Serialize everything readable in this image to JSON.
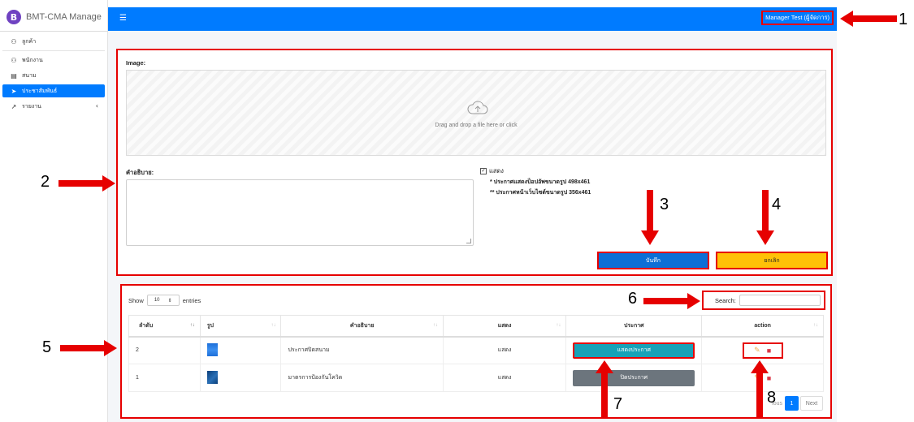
{
  "brand": {
    "logo_letter": "B",
    "name": "BMT-CMA Manage"
  },
  "sidebar": {
    "items": [
      {
        "label": "ลูกค้า",
        "icon": "users-icon"
      },
      {
        "label": "พนักงาน",
        "icon": "staff-icon"
      },
      {
        "label": "สนาม",
        "icon": "field-icon"
      },
      {
        "label": "ประชาสัมพันธ์",
        "icon": "send-icon",
        "active": true
      },
      {
        "label": "รายงาน",
        "icon": "chart-icon",
        "has_submenu": true
      }
    ]
  },
  "topbar": {
    "menu_icon": "menu-icon",
    "user": "Manager Test (ผู้จัดการ)"
  },
  "form": {
    "image_label": "Image:",
    "dropzone_text": "Drag and drop a file here or click",
    "description_label": "คำอธิบาย:",
    "show_label": "แสดง",
    "note1": "* ประกาศแสดงป็อปอัพขนาดรูป 498x461",
    "note2": "** ประกาศหน้าเว็บไซต์ขนาดรูป 356x461",
    "save_label": "บันทึก",
    "cancel_label": "ยกเลิก"
  },
  "table": {
    "show": "Show",
    "entries_value": "10",
    "entries": "entries",
    "search_label": "Search:",
    "columns": [
      "ลำดับ",
      "รูป",
      "คำอธิบาย",
      "แสดง",
      "ประกาศ",
      "action"
    ],
    "rows": [
      {
        "order": "2",
        "description": "ประกาศปิดสนาม",
        "show": "แสดง",
        "announce": "แสดงประกาศ"
      },
      {
        "order": "1",
        "description": "มาตรการป้องกันโควิด",
        "show": "แสดง",
        "announce": "ปิดประกาศ"
      }
    ],
    "pagination": {
      "previous": "ious",
      "page": "1",
      "next": "Next"
    }
  },
  "callouts": [
    "1",
    "2",
    "3",
    "4",
    "5",
    "6",
    "7",
    "8"
  ]
}
